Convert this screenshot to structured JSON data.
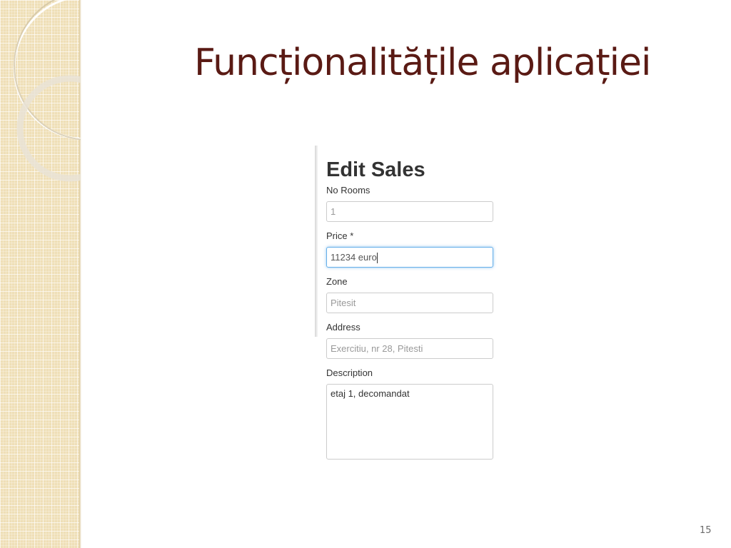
{
  "slide": {
    "title": "Funcționalitățile aplicației",
    "page_number": "15",
    "colors": {
      "title": "#5a1a14",
      "panel": "#efdfb7",
      "focus": "#66afe9"
    }
  },
  "form": {
    "title": "Edit Sales",
    "fields": [
      {
        "label": "No Rooms",
        "value": "1",
        "type": "input"
      },
      {
        "label": "Price *",
        "value": "11234 euro",
        "type": "input",
        "focused": true
      },
      {
        "label": "Zone",
        "value": "Pitesit",
        "type": "input"
      },
      {
        "label": "Address",
        "value": "Exercitiu, nr 28, Pitesti",
        "type": "input"
      },
      {
        "label": "Description",
        "value": "etaj 1, decomandat",
        "type": "textarea"
      }
    ]
  }
}
